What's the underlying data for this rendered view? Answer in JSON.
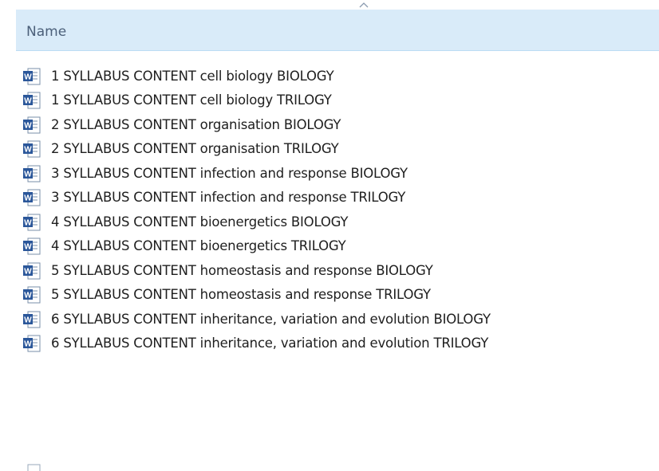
{
  "header": {
    "column_name": "Name",
    "sort_indicator_icon": "chevron-up-icon"
  },
  "files": [
    {
      "name": "1 SYLLABUS CONTENT cell biology BIOLOGY",
      "icon": "word-document-icon"
    },
    {
      "name": "1 SYLLABUS CONTENT cell biology TRILOGY",
      "icon": "word-document-icon"
    },
    {
      "name": "2 SYLLABUS CONTENT organisation BIOLOGY",
      "icon": "word-document-icon"
    },
    {
      "name": "2 SYLLABUS CONTENT organisation TRILOGY",
      "icon": "word-document-icon"
    },
    {
      "name": "3 SYLLABUS CONTENT infection and response BIOLOGY",
      "icon": "word-document-icon"
    },
    {
      "name": "3 SYLLABUS CONTENT infection and response TRILOGY",
      "icon": "word-document-icon"
    },
    {
      "name": "4 SYLLABUS CONTENT bioenergetics BIOLOGY",
      "icon": "word-document-icon"
    },
    {
      "name": "4 SYLLABUS CONTENT bioenergetics TRILOGY",
      "icon": "word-document-icon"
    },
    {
      "name": "5 SYLLABUS CONTENT homeostasis and response BIOLOGY",
      "icon": "word-document-icon"
    },
    {
      "name": "5 SYLLABUS CONTENT homeostasis and response TRILOGY",
      "icon": "word-document-icon"
    },
    {
      "name": "6 SYLLABUS CONTENT inheritance, variation and evolution BIOLOGY",
      "icon": "word-document-icon"
    },
    {
      "name": "6 SYLLABUS CONTENT inheritance, variation and evolution TRILOGY",
      "icon": "word-document-icon"
    }
  ],
  "colors": {
    "header_bg": "#d9ebf9",
    "header_text": "#4c607a",
    "word_blue": "#2b579a",
    "text": "#1e1e1e"
  }
}
